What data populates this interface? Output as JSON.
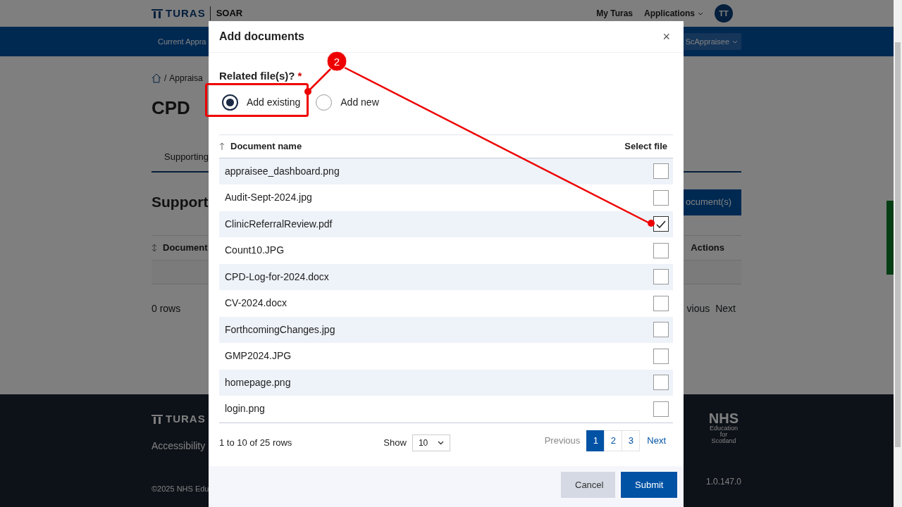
{
  "app": {
    "logo": "TURAS",
    "product": "SOAR",
    "nav_links": [
      "My Turas",
      "Applications"
    ],
    "avatar": "TT"
  },
  "subnav": {
    "left": "Current Appra",
    "right": "ScAppraisee"
  },
  "page": {
    "breadcrumb_separator": "/",
    "breadcrumb": "Appraisa",
    "title": "CPD",
    "tab": "Supporting",
    "section": "Support",
    "add_button": "ocument(s)",
    "table_columns": [
      "Document",
      "Actions"
    ],
    "row_count": "0 rows",
    "pager": [
      "vious",
      "Next"
    ]
  },
  "footer": {
    "logo": "TURAS",
    "links": [
      "Accessibility"
    ],
    "copyright": "©2025 NHS Edu",
    "org": "NHS",
    "org_lines": [
      "Education",
      "for",
      "Scotland"
    ],
    "version": "1.0.147.0"
  },
  "modal": {
    "title": "Add documents",
    "close": "×",
    "question": "Related file(s)?",
    "required": "*",
    "options": [
      {
        "label": "Add existing",
        "selected": true
      },
      {
        "label": "Add new",
        "selected": false
      }
    ],
    "columns": [
      "Document name",
      "Select file"
    ],
    "files": [
      {
        "name": "appraisee_dashboard.png",
        "checked": false
      },
      {
        "name": "Audit-Sept-2024.jpg",
        "checked": false
      },
      {
        "name": "ClinicReferralReview.pdf",
        "checked": true
      },
      {
        "name": "Count10.JPG",
        "checked": false
      },
      {
        "name": "CPD-Log-for-2024.docx",
        "checked": false
      },
      {
        "name": "CV-2024.docx",
        "checked": false
      },
      {
        "name": "ForthcomingChanges.jpg",
        "checked": false
      },
      {
        "name": "GMP2024.JPG",
        "checked": false
      },
      {
        "name": "homepage.png",
        "checked": false
      },
      {
        "name": "login.png",
        "checked": false
      }
    ],
    "summary": "1 to 10 of 25 rows",
    "show_label": "Show",
    "page_size": "10",
    "previous": {
      "label": "Previous",
      "disabled": true
    },
    "pages": [
      {
        "label": "1",
        "selected": true
      },
      {
        "label": "2",
        "selected": false
      },
      {
        "label": "3",
        "selected": false
      }
    ],
    "next": {
      "label": "Next",
      "disabled": false
    },
    "buttons": [
      {
        "label": "Cancel",
        "kind": "secondary"
      },
      {
        "label": "Submit",
        "kind": "primary"
      }
    ]
  },
  "annotation": {
    "number": "2"
  }
}
